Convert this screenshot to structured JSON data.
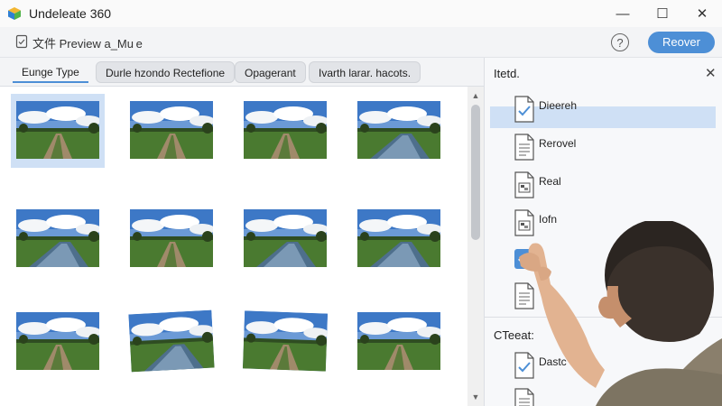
{
  "window": {
    "title": "Undeleate 360",
    "minimize_glyph": "—",
    "maximize_glyph": "☐",
    "close_glyph": "✕"
  },
  "toolbar": {
    "title": "文件 Preview a_Mu e",
    "help_glyph": "?",
    "recover_label": "Reover"
  },
  "tabs": [
    {
      "label": "Eunge Type",
      "active": true
    },
    {
      "label": "Durle hzondo Rectefione",
      "active": false
    },
    {
      "label": "Opagerant",
      "active": false
    },
    {
      "label": "Ivarth larar. hacots.",
      "active": false
    }
  ],
  "grid": {
    "rows": 3,
    "cols": 4,
    "selected_index": 0,
    "items": [
      {
        "scene": "path-field"
      },
      {
        "scene": "path-field"
      },
      {
        "scene": "path-field"
      },
      {
        "scene": "river-field"
      },
      {
        "scene": "river-field"
      },
      {
        "scene": "path-field"
      },
      {
        "scene": "river-field"
      },
      {
        "scene": "river-field"
      },
      {
        "scene": "path-field"
      },
      {
        "scene": "river-field"
      },
      {
        "scene": "path-field"
      },
      {
        "scene": "path-field"
      }
    ]
  },
  "scrollbar": {
    "up_glyph": "▲",
    "down_glyph": "▼"
  },
  "side_panel": {
    "title": "Itetd.",
    "close_glyph": "✕",
    "items": [
      {
        "label": "Dieereh",
        "icon": "document-check-icon",
        "highlight": true
      },
      {
        "label": "Rerovel",
        "icon": "document-text-icon",
        "highlight": false
      },
      {
        "label": "Real",
        "icon": "document-image-icon",
        "highlight": false
      },
      {
        "label": "Iofn",
        "icon": "document-image-icon",
        "highlight": false
      },
      {
        "label": "",
        "icon": "checkbox-checked-icon",
        "highlight": false
      },
      {
        "label": "",
        "icon": "document-text-icon",
        "highlight": false
      }
    ],
    "section_title": "CTeeat:",
    "section_items": [
      {
        "label": "Dastc",
        "icon": "document-check-icon"
      },
      {
        "label": "",
        "icon": "document-text-icon"
      }
    ]
  },
  "colors": {
    "accent": "#4d8fd6",
    "selection": "#cfe0f5",
    "sky": "#3d78c6",
    "grass": "#3f6b2b"
  }
}
